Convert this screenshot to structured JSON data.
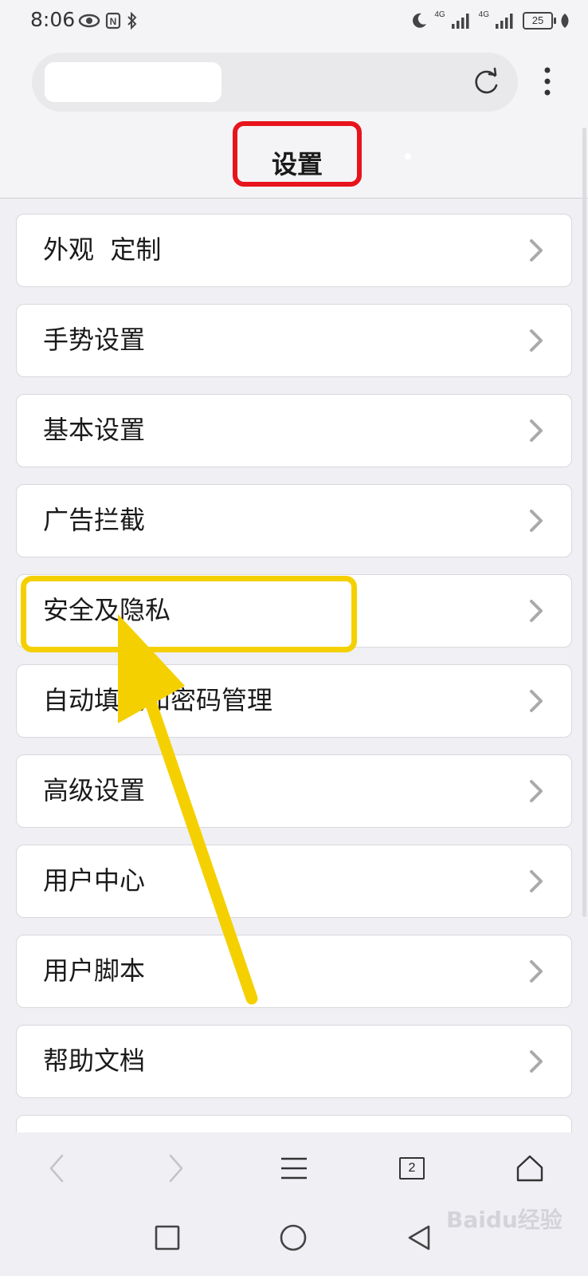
{
  "status_bar": {
    "time": "8:06",
    "network_1": "4G",
    "network_2": "4G",
    "battery": "25"
  },
  "browser_bar": {
    "url_value": "",
    "reload_icon": "reload-icon",
    "more_icon": "more-vertical-icon"
  },
  "header": {
    "title": "设置"
  },
  "settings": {
    "items": [
      {
        "label": "外观  定制"
      },
      {
        "label": "手势设置"
      },
      {
        "label": "基本设置"
      },
      {
        "label": "广告拦截"
      },
      {
        "label": "安全及隐私"
      },
      {
        "label": "自动填充和密码管理"
      },
      {
        "label": "高级设置"
      },
      {
        "label": "用户中心"
      },
      {
        "label": "用户脚本"
      },
      {
        "label": "帮助文档"
      },
      {
        "label": ""
      }
    ]
  },
  "toolbar": {
    "back_icon": "chevron-left-icon",
    "forward_icon": "chevron-right-icon",
    "menu_icon": "menu-icon",
    "tab_count": "2",
    "home_icon": "home-icon"
  },
  "navbar": {
    "recents_icon": "square-icon",
    "home_icon": "circle-icon",
    "back_icon": "triangle-back-icon"
  },
  "annotation": {
    "highlight_color": "#f5d000",
    "title_box_color": "#e8141c"
  },
  "watermark": "Baidu经验"
}
